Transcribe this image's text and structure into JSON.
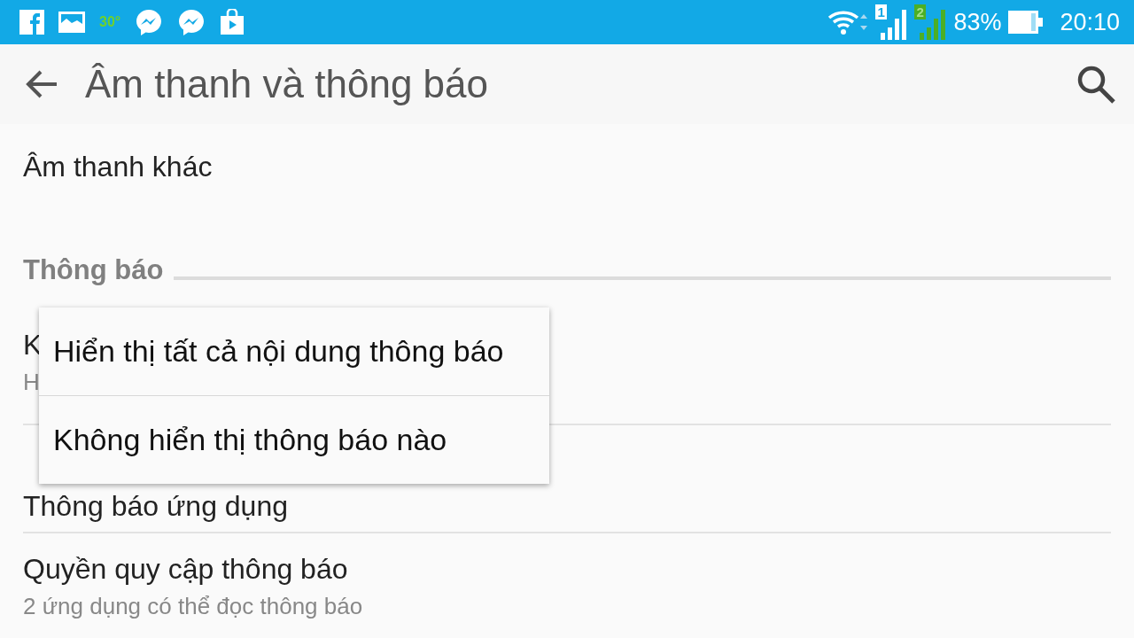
{
  "status_bar": {
    "temperature": "30°",
    "sim_1": "1",
    "sim_2": "2",
    "battery": "83%",
    "time": "20:10"
  },
  "app_bar": {
    "title": "Âm thanh và thông báo"
  },
  "items": [
    {
      "kind": "item",
      "title": "Âm thanh khác"
    },
    {
      "kind": "header",
      "title": "Thông báo"
    },
    {
      "kind": "item",
      "title": "K",
      "subtitle": "H"
    },
    {
      "kind": "item",
      "title": "Thông báo ứng dụng"
    },
    {
      "kind": "item",
      "title": "Quyền quy cập thông báo",
      "subtitle": "2 ứng dụng có thể đọc thông báo"
    }
  ],
  "menu": {
    "options": [
      "Hiển thị tất cả nội dung thông báo",
      "Không hiển thị thông báo nào"
    ]
  }
}
